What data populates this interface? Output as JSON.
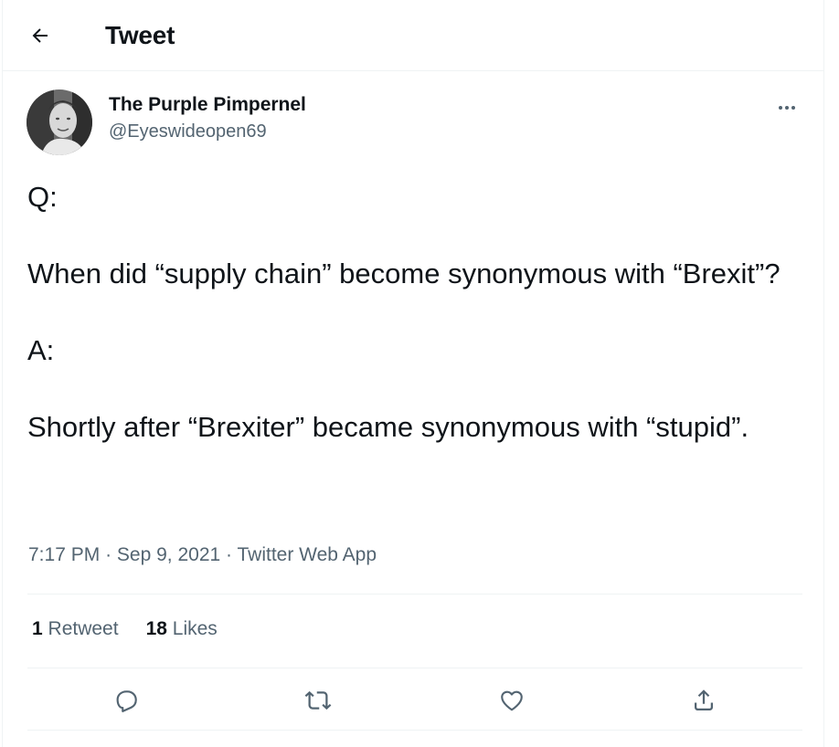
{
  "header": {
    "title": "Tweet",
    "back_icon": "arrow-left-icon"
  },
  "author": {
    "display_name": "The Purple Pimpernel",
    "handle": "@Eyeswideopen69"
  },
  "tweet": {
    "lines": [
      "Q:",
      "When did “supply chain” become synonymous with “Brexit”?",
      "A:",
      "Shortly after “Brexiter” became synonymous with “stupid”."
    ],
    "time": "7:17 PM",
    "date": "Sep 9, 2021",
    "source": "Twitter Web App",
    "separator": "·"
  },
  "stats": {
    "retweets_count": "1",
    "retweets_label": "Retweet",
    "likes_count": "18",
    "likes_label": "Likes"
  },
  "actions": [
    "reply-icon",
    "retweet-icon",
    "like-icon",
    "share-icon"
  ],
  "colors": {
    "text": "#0f1419",
    "secondary": "#536471",
    "divider": "#eff3f4"
  }
}
